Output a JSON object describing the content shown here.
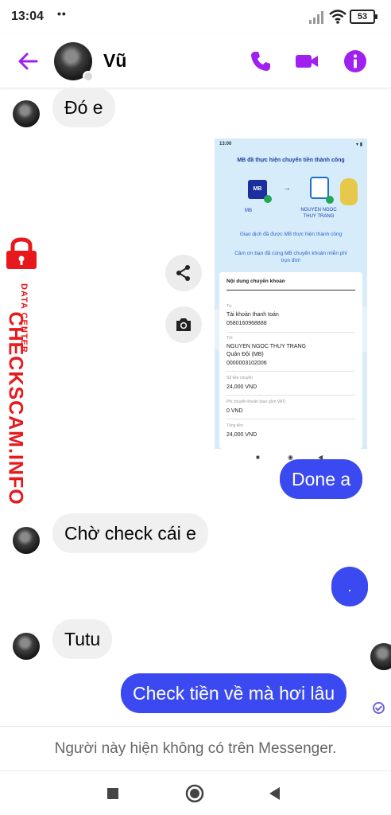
{
  "status_bar": {
    "time": "13:04",
    "notification_dots": "••",
    "battery": "53"
  },
  "header": {
    "contact_name": "Vũ",
    "icons": [
      "back-arrow-icon",
      "phone-icon",
      "video-camera-icon",
      "info-icon"
    ]
  },
  "colors": {
    "accent": "#a020f0",
    "outgoing_bubble": "#3b4af0",
    "incoming_bubble": "#f0f0f0",
    "watermark": "#e8191d"
  },
  "messages": [
    {
      "direction": "in",
      "text": "Đó e"
    },
    {
      "direction": "out",
      "type": "image",
      "description": "bank transfer screenshot"
    },
    {
      "direction": "out",
      "text": "Done a"
    },
    {
      "direction": "in",
      "text": "Chờ check cái e"
    },
    {
      "direction": "out",
      "text": "."
    },
    {
      "direction": "in",
      "text": "Tutu"
    },
    {
      "direction": "out",
      "text": "Check tiền về mà hơi lâu"
    }
  ],
  "transfer_screenshot": {
    "status_time": "13:00",
    "title": "MB đã thực hiện chuyển tiền thành công",
    "bank_logo": "MB",
    "bank_label": "MB",
    "recipient_label": "NGUYEN NGOC THUY TRANG",
    "success_line": "Giao dịch đã được MB thực hiện thành công",
    "thanks_line": "Cảm ơn bạn đã cùng MB chuyển khoản miễn phí trọn đời!",
    "card_title": "Nội dung chuyển khoản",
    "from_label": "Từ",
    "from_account_type": "Tài khoản thanh toán",
    "from_account_number": "0580160968888",
    "to_label": "Tới",
    "to_name": "NGUYEN NGOC THUY TRANG",
    "to_bank": "Quân Đội (MB)",
    "to_account_number": "0000003102006",
    "amount_label": "Số tiền chuyển",
    "amount": "24,000 VND",
    "fee_label": "Phí chuyển khoản (bao gồm VAT)",
    "fee": "0 VND",
    "total_label": "Tổng tiền",
    "total": "24,000 VND",
    "nav_glyphs": [
      "■",
      "◉",
      "◀"
    ]
  },
  "image_actions": [
    "share-icon",
    "camera-icon"
  ],
  "watermark": {
    "big_text": "CHECKSCAM.INFO",
    "small_text": "DATA CENTER"
  },
  "footer": {
    "notice": "Người này hiện không có trên Messenger."
  },
  "nav_bar": {
    "buttons": [
      "recents-square-icon",
      "home-circle-icon",
      "back-triangle-icon"
    ]
  }
}
